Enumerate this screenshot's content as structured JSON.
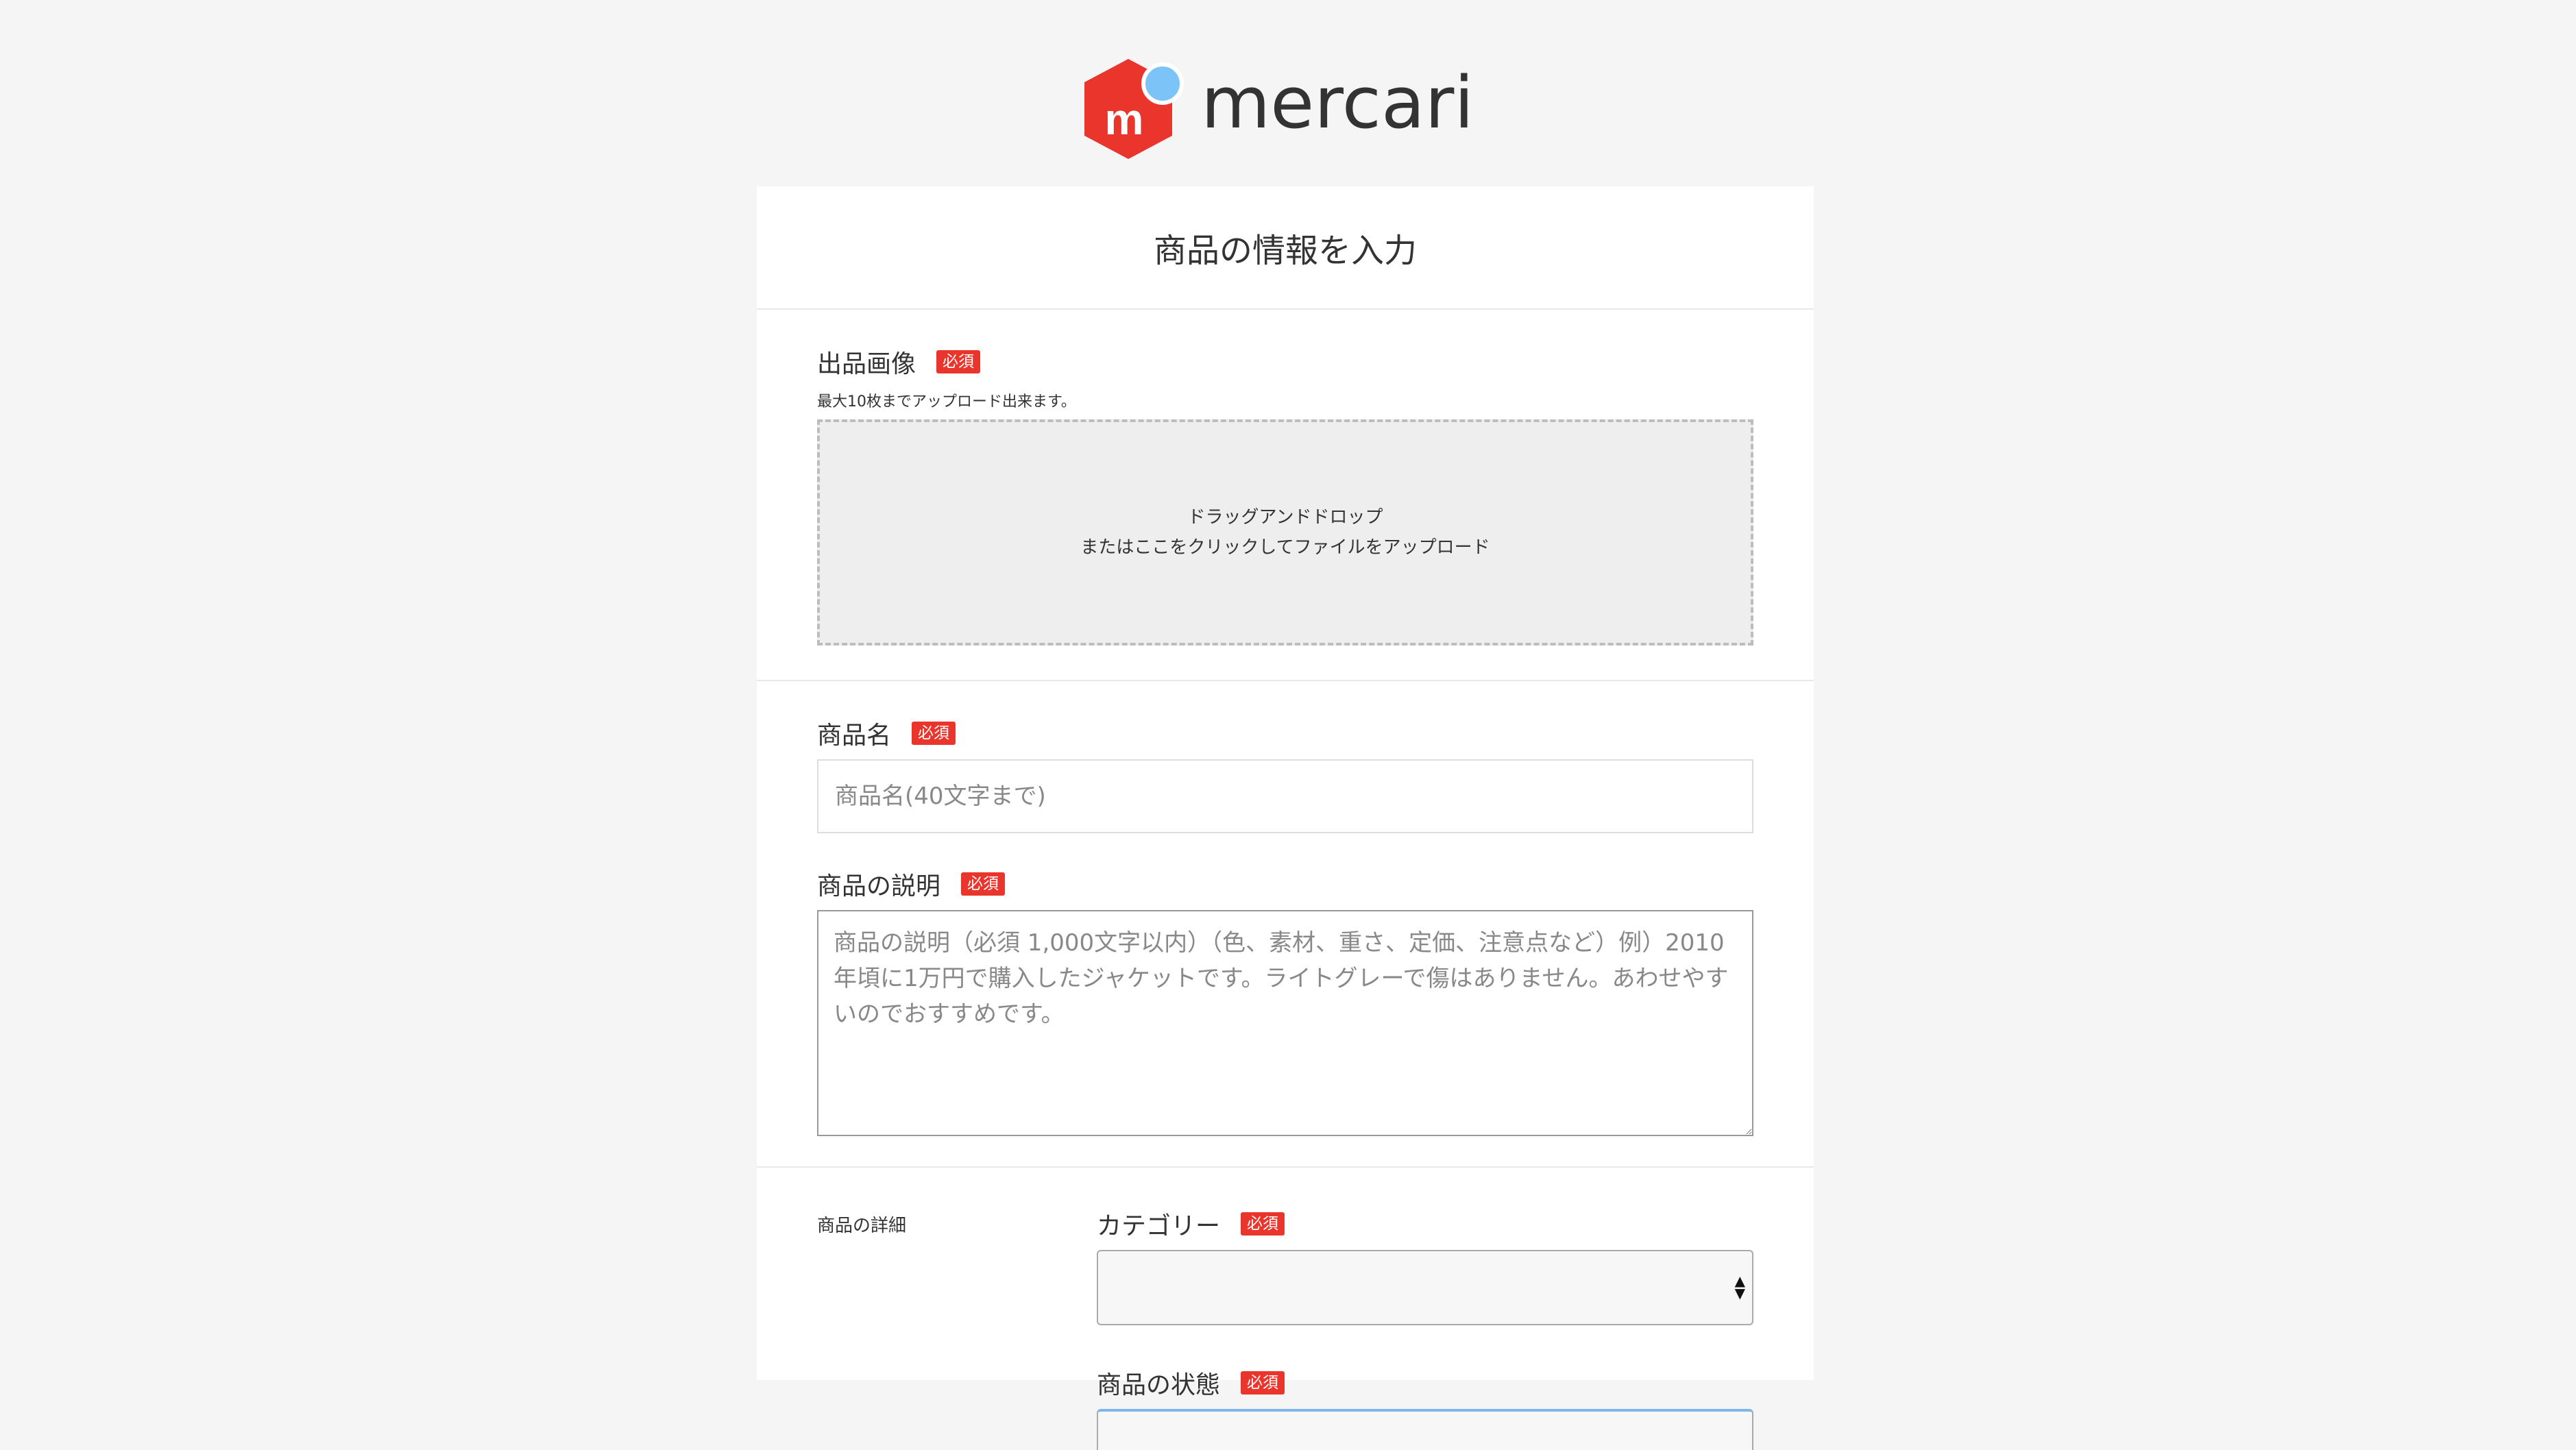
{
  "brand": {
    "logo_text": "mercari",
    "logo_mark": "m",
    "colors": {
      "red": "#ea352d",
      "blue": "#7cc4f8",
      "text": "#333333"
    }
  },
  "page": {
    "title": "商品の情報を入力"
  },
  "required_badge": "必須",
  "image_section": {
    "label": "出品画像",
    "hint": "最大10枚までアップロード出来ます。",
    "dropzone_line1": "ドラッグアンドドロップ",
    "dropzone_line2": "またはここをクリックしてファイルをアップロード"
  },
  "name_field": {
    "label": "商品名",
    "placeholder": "商品名(40文字まで)",
    "value": ""
  },
  "description_field": {
    "label": "商品の説明",
    "placeholder": "商品の説明（必須 1,000文字以内）（色、素材、重さ、定価、注意点など）例）2010年頃に1万円で購入したジャケットです。ライトグレーで傷はありません。あわせやすいのでおすすめです。",
    "value": ""
  },
  "details_section": {
    "title": "商品の詳細",
    "category": {
      "label": "カテゴリー",
      "selected": ""
    },
    "condition": {
      "label": "商品の状態"
    }
  }
}
